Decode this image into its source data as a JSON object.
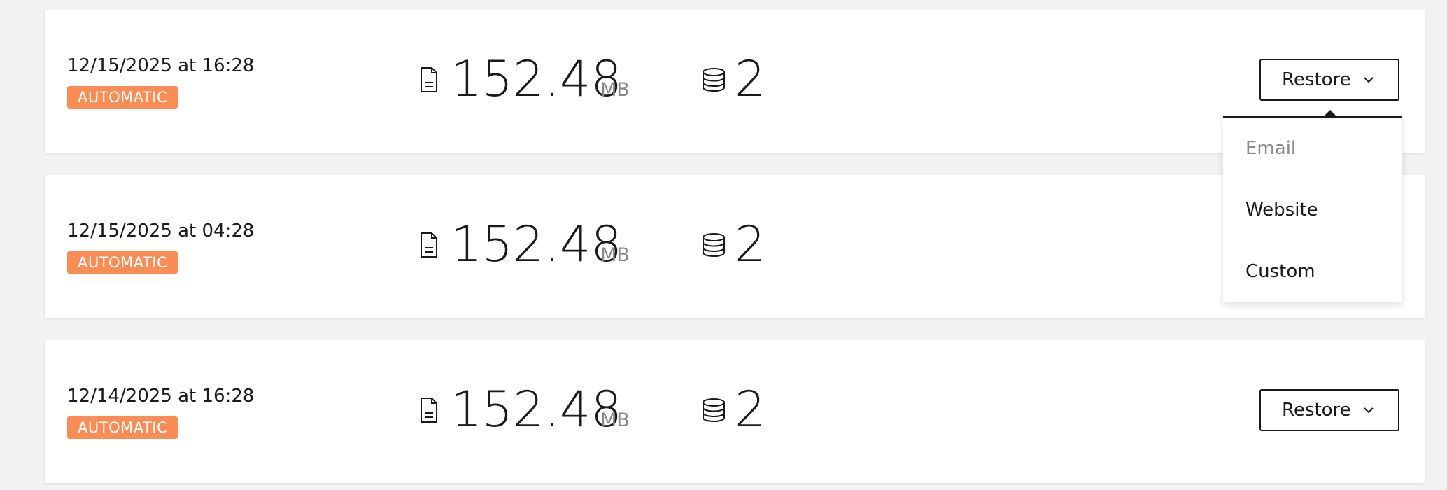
{
  "backups": [
    {
      "date": "12/15/2025 at 16:28",
      "type_badge": "AUTOMATIC",
      "size_value": "152.48",
      "size_unit": "MB",
      "db_count": "2",
      "restore_label": "Restore"
    },
    {
      "date": "12/15/2025 at 04:28",
      "type_badge": "AUTOMATIC",
      "size_value": "152.48",
      "size_unit": "MB",
      "db_count": "2"
    },
    {
      "date": "12/14/2025 at 16:28",
      "type_badge": "AUTOMATIC",
      "size_value": "152.48",
      "size_unit": "MB",
      "db_count": "2",
      "restore_label": "Restore"
    }
  ],
  "restore_menu": {
    "items": [
      {
        "label": "Email",
        "disabled": true
      },
      {
        "label": "Website",
        "disabled": false
      },
      {
        "label": "Custom",
        "disabled": false
      }
    ]
  },
  "icons": {
    "size": "file-document-icon",
    "databases": "database-icon",
    "dropdown": "chevron-down-icon"
  },
  "colors": {
    "background": "#f2f2f2",
    "card": "#ffffff",
    "badge": "#fa8c55",
    "text": "#1a1a1a",
    "muted": "#888888"
  }
}
